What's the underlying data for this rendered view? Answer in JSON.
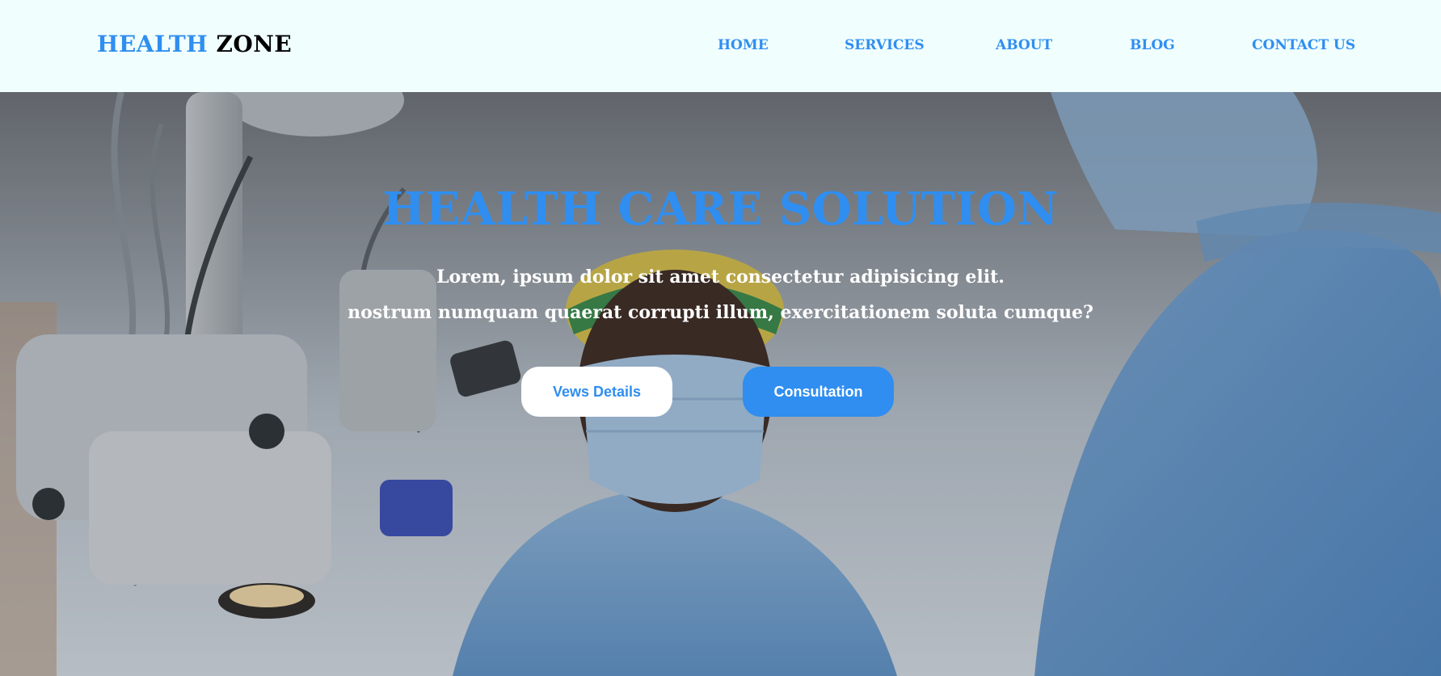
{
  "navbar": {
    "logo_accent": "HEALTH",
    "logo_rest": "ZONE",
    "links": [
      {
        "label": "HOME"
      },
      {
        "label": "SERVICES"
      },
      {
        "label": "ABOUT"
      },
      {
        "label": "BLOG"
      },
      {
        "label": "CONTACT US"
      }
    ]
  },
  "hero": {
    "title": "HEALTH CARE SOLUTION",
    "subtitle_line1": "Lorem, ipsum dolor sit amet consectetur adipisicing elit.",
    "subtitle_line2": "nostrum numquam quaerat corrupti illum, exercitationem soluta cumque?",
    "buttons": {
      "details_label": "Vews Details",
      "consult_label": "Consultation"
    }
  },
  "colors": {
    "accent": "#2f8ef0",
    "navbar_bg": "#f0fffe",
    "white": "#ffffff",
    "black": "#000000"
  }
}
